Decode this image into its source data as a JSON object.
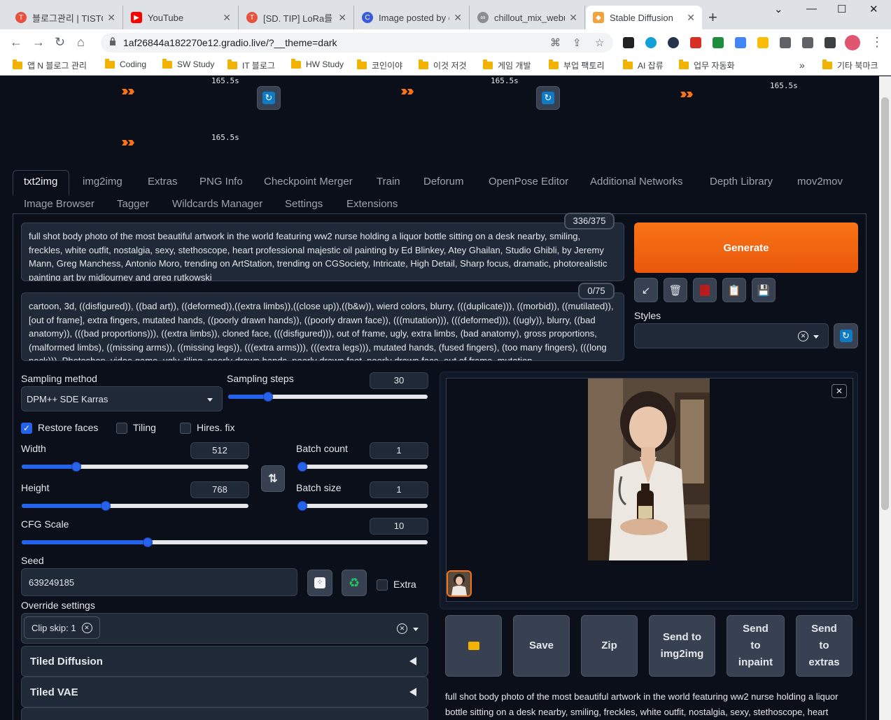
{
  "browser": {
    "tabs": [
      {
        "title": "블로그관리 | TISTO",
        "fav_color": "#e8513e"
      },
      {
        "title": "YouTube",
        "fav_color": "#ff0000"
      },
      {
        "title": "[SD. TIP] LoRa를 실",
        "fav_color": "#e8513e"
      },
      {
        "title": "Image posted by c",
        "fav_color": "#3b5bdb"
      },
      {
        "title": "chillout_mix_webui",
        "fav_color": "#8a8d91"
      },
      {
        "title": "Stable Diffusion",
        "fav_color": "#f4a23b"
      }
    ],
    "url": "1af26844a182270e12.gradio.live/?__theme=dark",
    "bookmarks": [
      "앱 N 블로그 관리",
      "Coding",
      "SW Study",
      "IT 블로그",
      "HW Study",
      "코인이야",
      "이것 저것",
      "게임 개발",
      "부업 팩토리",
      "AI 잡류",
      "업무 자동화"
    ],
    "other_bookmarks": "기타 북마크"
  },
  "progress": {
    "times": [
      "165.5s",
      "165.5s",
      "165.5s",
      "165.5s"
    ]
  },
  "tabs": {
    "row1": [
      "txt2img",
      "img2img",
      "Extras",
      "PNG Info",
      "Checkpoint Merger",
      "Train",
      "Deforum",
      "OpenPose Editor",
      "Additional Networks",
      "Depth Library",
      "mov2mov"
    ],
    "row2": [
      "Image Browser",
      "Tagger",
      "Wildcards Manager",
      "Settings",
      "Extensions"
    ]
  },
  "prompt": {
    "text": "full shot body photo of the most beautiful artwork in the world featuring ww2 nurse holding a liquor bottle sitting on a desk nearby, smiling, freckles, white outfit, nostalgia, sexy, stethoscope,  heart professional majestic oil painting by Ed Blinkey, Atey Ghailan, Studio Ghibli, by Jeremy Mann, Greg Manchess, Antonio Moro, trending on ArtStation, trending on CGSociety, Intricate, High Detail, Sharp focus, dramatic, photorealistic painting art by midjourney and greg rutkowski",
    "counter": "336/375"
  },
  "negative_prompt": {
    "text": "cartoon, 3d, ((disfigured)), ((bad art)), ((deformed)),((extra limbs)),((close up)),((b&w)), wierd colors, blurry,  (((duplicate))), ((morbid)), ((mutilated)), [out of frame], extra fingers, mutated hands, ((poorly drawn hands)), ((poorly drawn face)), (((mutation))), (((deformed))), ((ugly)), blurry, ((bad anatomy)), (((bad proportions))), ((extra limbs)), cloned face, (((disfigured))), out of frame, ugly, extra limbs, (bad anatomy), gross proportions, (malformed limbs), ((missing arms)), ((missing legs)), (((extra arms))), (((extra legs))), mutated hands, (fused fingers), (too many fingers), (((long neck))), Photoshop, video game, ugly, tiling, poorly drawn hands, poorly drawn feet, poorly drawn face, out of frame, mutation",
    "counter": "0/75"
  },
  "generate_label": "Generate",
  "styles_label": "Styles",
  "sampling": {
    "method_label": "Sampling method",
    "method": "DPM++ SDE Karras",
    "steps_label": "Sampling steps",
    "steps": "30",
    "steps_fraction": 0.2
  },
  "options": {
    "restore_faces": "Restore faces",
    "restore_faces_checked": true,
    "tiling": "Tiling",
    "hires_fix": "Hires. fix"
  },
  "size": {
    "width_label": "Width",
    "width": "512",
    "width_fraction": 0.24,
    "height_label": "Height",
    "height": "768",
    "height_fraction": 0.37
  },
  "batch": {
    "count_label": "Batch count",
    "count": "1",
    "size_label": "Batch size",
    "size": "1"
  },
  "cfg": {
    "label": "CFG Scale",
    "value": "10",
    "fraction": 0.31
  },
  "seed": {
    "label": "Seed",
    "value": "639249185",
    "extra": "Extra"
  },
  "override": {
    "label": "Override settings",
    "chip": "Clip skip: 1"
  },
  "accordions": [
    "Tiled Diffusion",
    "Tiled VAE"
  ],
  "actions": {
    "save": "Save",
    "zip": "Zip",
    "send_img2img": "Send to img2img",
    "send_inpaint": "Send to inpaint",
    "send_extras": "Send to extras"
  },
  "output_text": "full shot body photo of the most beautiful artwork in the world featuring ww2 nurse holding a liquor bottle sitting on a desk nearby, smiling, freckles, white outfit, nostalgia, sexy, stethoscope, heart"
}
